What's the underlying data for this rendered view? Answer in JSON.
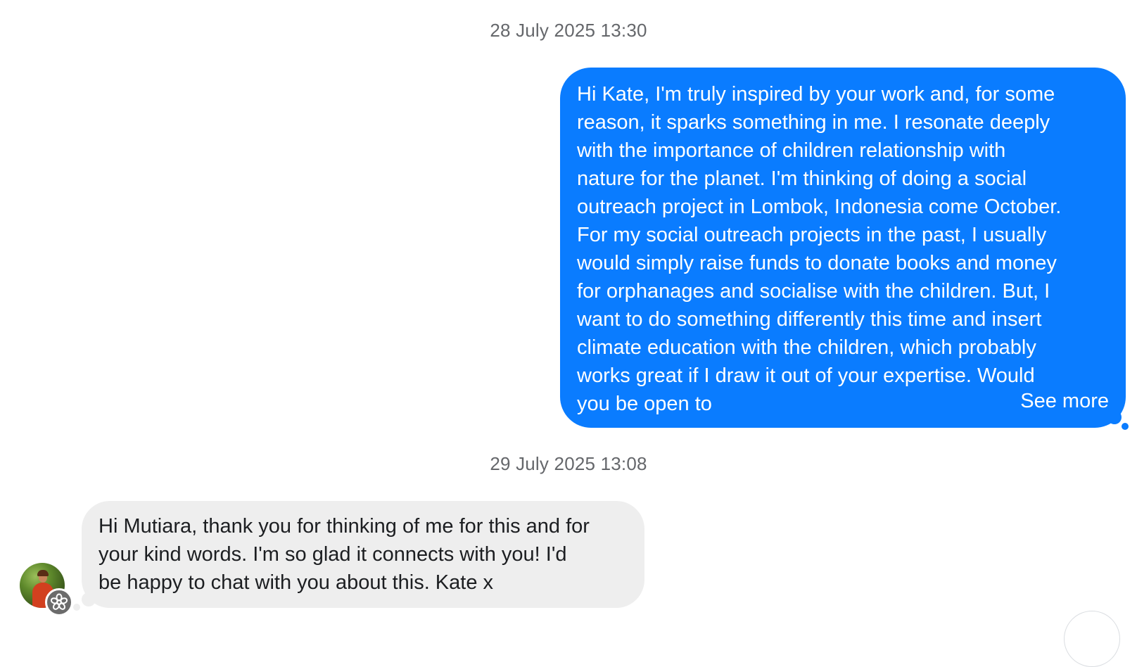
{
  "conversation": {
    "timestamps": {
      "first": "28 July 2025 13:30",
      "second": "29 July 2025 13:08"
    },
    "outgoing_message": {
      "text": "Hi Kate, I'm truly inspired by your work and, for some\nreason, it sparks something in me. I resonate deeply\nwith the importance of children relationship with\nnature for the planet. I'm thinking of doing a social\noutreach project in Lombok, Indonesia come October.\nFor my social outreach projects in the past, I usually\nwould simply raise funds to donate books and money\nfor orphanages and socialise with the children. But, I\nwant to do something differently this time and insert\nclimate education with the children, which probably\nworks great if I draw it out of your expertise. Would\nyou be open to",
      "see_more_label": "See more",
      "bubble_color": "#0a7cff"
    },
    "incoming_message": {
      "text": "Hi Mutiara, thank you for thinking of me for this and for\nyour kind words. I'm so glad it connects with you! I'd\nbe happy to chat with you about this. Kate x",
      "bubble_color": "#eeeeee"
    },
    "avatar_badge_icon": "flower-badge-icon"
  }
}
